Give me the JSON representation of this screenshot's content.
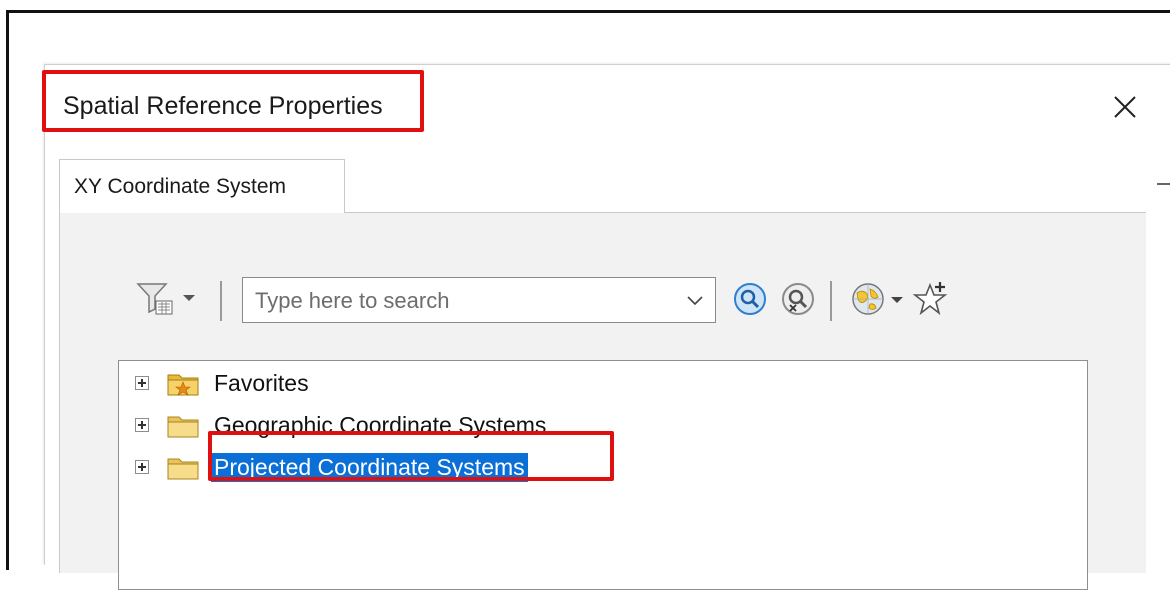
{
  "dialog": {
    "title": "Spatial Reference Properties",
    "close_icon": "close-icon"
  },
  "tabs": [
    {
      "label": "XY Coordinate System",
      "active": true
    }
  ],
  "toolbar": {
    "filter_icon": "filter-icon",
    "search_placeholder": "Type here to search",
    "search_value": "",
    "search_button_icon": "search-icon",
    "clear_search_icon": "clear-search-icon",
    "globe_icon": "globe-icon",
    "favorite_icon": "add-favorite-icon"
  },
  "tree": {
    "items": [
      {
        "label": "Favorites",
        "icon": "favorites-folder-icon",
        "selected": false
      },
      {
        "label": "Geographic Coordinate Systems",
        "icon": "folder-icon",
        "selected": false
      },
      {
        "label": "Projected Coordinate Systems",
        "icon": "folder-icon",
        "selected": true
      }
    ]
  },
  "colors": {
    "highlight_box": "#e01010",
    "selection": "#0a6fd6",
    "accent_search": "#1e73c8"
  }
}
